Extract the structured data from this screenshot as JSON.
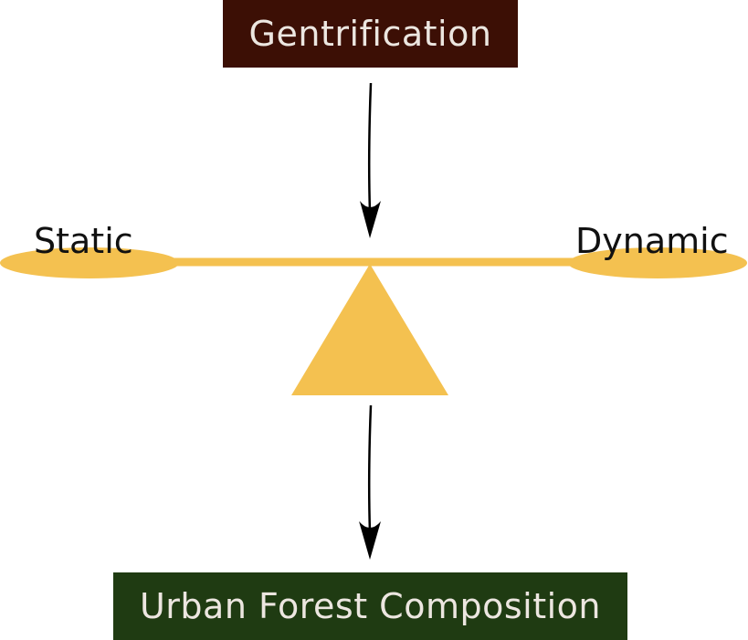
{
  "nodes": {
    "top": {
      "label": "Gentrification",
      "color": "#3c0f05"
    },
    "bottom": {
      "label": "Urban Forest Composition",
      "color": "#1f3b12"
    }
  },
  "balance": {
    "left_label": "Static",
    "right_label": "Dynamic",
    "color": "#f4c150"
  },
  "arrows": {
    "color": "#000000"
  }
}
